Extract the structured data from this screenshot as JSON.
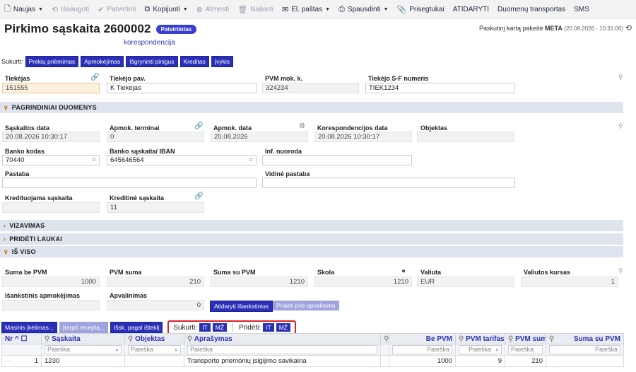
{
  "toolbar": {
    "items": [
      {
        "label": "Naujas",
        "icon": "new-doc-icon",
        "caret": true,
        "disabled": false
      },
      {
        "label": "Išsaugoti",
        "icon": "save-icon",
        "disabled": true
      },
      {
        "label": "Patvirtinti",
        "icon": "check-icon",
        "disabled": true
      },
      {
        "label": "Kopijuoti",
        "icon": "copy-icon",
        "caret": true,
        "disabled": false
      },
      {
        "label": "Atmesti",
        "icon": "cancel-icon",
        "disabled": true
      },
      {
        "label": "Naikinti",
        "icon": "trash-icon",
        "disabled": true
      },
      {
        "label": "El. paštas",
        "icon": "mail-icon",
        "caret": true,
        "disabled": false
      },
      {
        "label": "Spausdinti",
        "icon": "print-icon",
        "caret": true,
        "disabled": false
      },
      {
        "label": "Prisegtukai",
        "icon": "paperclip-icon",
        "disabled": false
      },
      {
        "label": "ATIDARYTI",
        "disabled": false
      },
      {
        "label": "Duomenų transportas",
        "disabled": false
      },
      {
        "label": "SMS",
        "disabled": false
      }
    ]
  },
  "header": {
    "title": "Pirkimo sąskaita 2600002",
    "status": "Patvirtintas",
    "last_changed_prefix": "Paskutinį kartą pakeitė",
    "last_changed_user": "META",
    "last_changed_time": "(20.08.2026 - 10:31:06)",
    "link": "korespondencija"
  },
  "create": {
    "label": "Sukurti:",
    "buttons": [
      "Prekių priėmimas",
      "Apmokėjimas",
      "Išgryninti pinigus",
      "Kreditas",
      "Įvykis"
    ]
  },
  "top_fields": {
    "tiekejas_label": "Tiekėjas",
    "tiekejas": "151555",
    "pav_label": "Tiekėjo pav.",
    "pav": "K Tiekejas",
    "pvm_label": "PVM mok. k.",
    "pvm": "324234",
    "sf_label": "Tiekėjo S-F numeris",
    "sf": "TIEK1234"
  },
  "sections": {
    "main": "PAGRINDINIAI DUOMENYS",
    "vizavimas": "VIZAVIMAS",
    "papildomi": "PRIDĖTI LAUKAI",
    "viso": "IŠ VISO"
  },
  "main": {
    "sask_data_label": "Sąskaitos data",
    "sask_data": "20.08.2026 10:30:17",
    "terminas_label": "Apmok. terminai",
    "terminas": "0",
    "apmok_data_label": "Apmok. data",
    "apmok_data": "20.08.2026",
    "koresp_data_label": "Korespondencijos data",
    "koresp_data": "20.08.2026 10:30:17",
    "objektas_label": "Objektas",
    "objektas": "",
    "bankas_label": "Banko kodas",
    "bankas": "70440",
    "iban_label": "Banko sąskaita/ IBAN",
    "iban": "645646564",
    "inf_label": "Inf. nuoroda",
    "inf": "",
    "pastaba_label": "Pastaba",
    "pastaba": "",
    "vidine_label": "Vidinė pastaba",
    "vidine": "",
    "kred_sask_label": "Kredituojama sąskaita",
    "kred_sask": "",
    "kred_label": "Kreditinė sąskaita",
    "kred": "11"
  },
  "totals": {
    "suma_label": "Suma be PVM",
    "suma": "1000",
    "pvm_label": "PVM suma",
    "pvm": "210",
    "su_pvm_label": "Suma su PVM",
    "su_pvm": "1210",
    "skola_label": "Skola",
    "skola": "1210",
    "valiuta_label": "Valiuta",
    "valiuta": "EUR",
    "kursas_label": "Valiutos kursas",
    "kursas": "1",
    "isankstinis_label": "Išankstinis apmokėjimas",
    "isankstinis": "",
    "apvalinimas_label": "Apvalinimas",
    "apvalinimas": "0",
    "btn_open": "Atidaryti išankstinius",
    "btn_add": "Pridėti prie apvalinimo"
  },
  "grid_tools": {
    "btn1": "Masinis įkėlimas...",
    "btn2": "Įterpti receptą...",
    "btn3": "Išsk. pagal išteklį",
    "sukurti": "Sukurti:",
    "prideti": "Pridėti:",
    "it": "IT",
    "mz": "MŽ"
  },
  "grid": {
    "columns": [
      "Nr",
      "Sąskaita",
      "Objektas",
      "Aprašymas",
      "",
      "Be PVM",
      "PVM tarifas",
      "PVM suma",
      "Suma su PVM"
    ],
    "filter_placeholder": "Paieška",
    "rows": [
      {
        "nr": "1",
        "dots": "···",
        "saskaita": "1230",
        "objektas": "",
        "aprasymas": "Transporto priemonių įsigijimo savikaina",
        "be_pvm": "1000",
        "tarifas": "9",
        "pvm_suma": "210",
        "su_pvm": ""
      }
    ]
  }
}
